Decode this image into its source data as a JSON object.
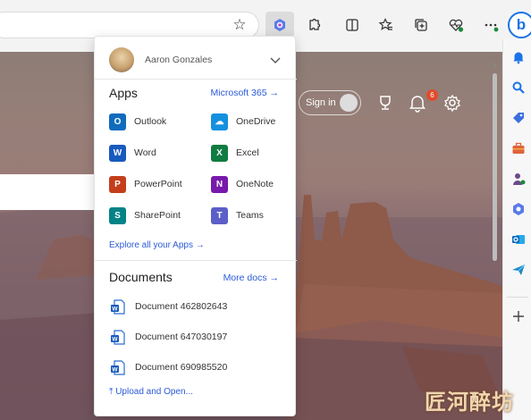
{
  "panel": {
    "account_name": "Aaron Gonzales",
    "apps_title": "Apps",
    "apps_link": "Microsoft 365 →",
    "apps": [
      {
        "label": "Outlook",
        "icon": "outlook-icon",
        "color": "#0f6cbd",
        "glyph": "O"
      },
      {
        "label": "OneDrive",
        "icon": "onedrive-icon",
        "color": "#1490df",
        "glyph": "☁"
      },
      {
        "label": "Word",
        "icon": "word-icon",
        "color": "#185abd",
        "glyph": "W"
      },
      {
        "label": "Excel",
        "icon": "excel-icon",
        "color": "#107c41",
        "glyph": "X"
      },
      {
        "label": "PowerPoint",
        "icon": "powerpoint-icon",
        "color": "#c43e1c",
        "glyph": "P"
      },
      {
        "label": "OneNote",
        "icon": "onenote-icon",
        "color": "#7719aa",
        "glyph": "N"
      },
      {
        "label": "SharePoint",
        "icon": "sharepoint-icon",
        "color": "#038387",
        "glyph": "S"
      },
      {
        "label": "Teams",
        "icon": "teams-icon",
        "color": "#5b5fc7",
        "glyph": "T"
      }
    ],
    "explore_link": "Explore all your Apps →",
    "docs_title": "Documents",
    "docs_link": "More docs →",
    "documents": [
      {
        "label": "Document 462802643"
      },
      {
        "label": "Document 647030197"
      },
      {
        "label": "Document 690985520"
      }
    ],
    "upload_link": "Upload and Open..."
  },
  "header": {
    "signin_label": "Sign in",
    "notification_count": "6"
  },
  "watermark": "匠河醉坊",
  "colors": {
    "accent": "#2b5bd8",
    "toolbar": "#f3f3f3"
  }
}
